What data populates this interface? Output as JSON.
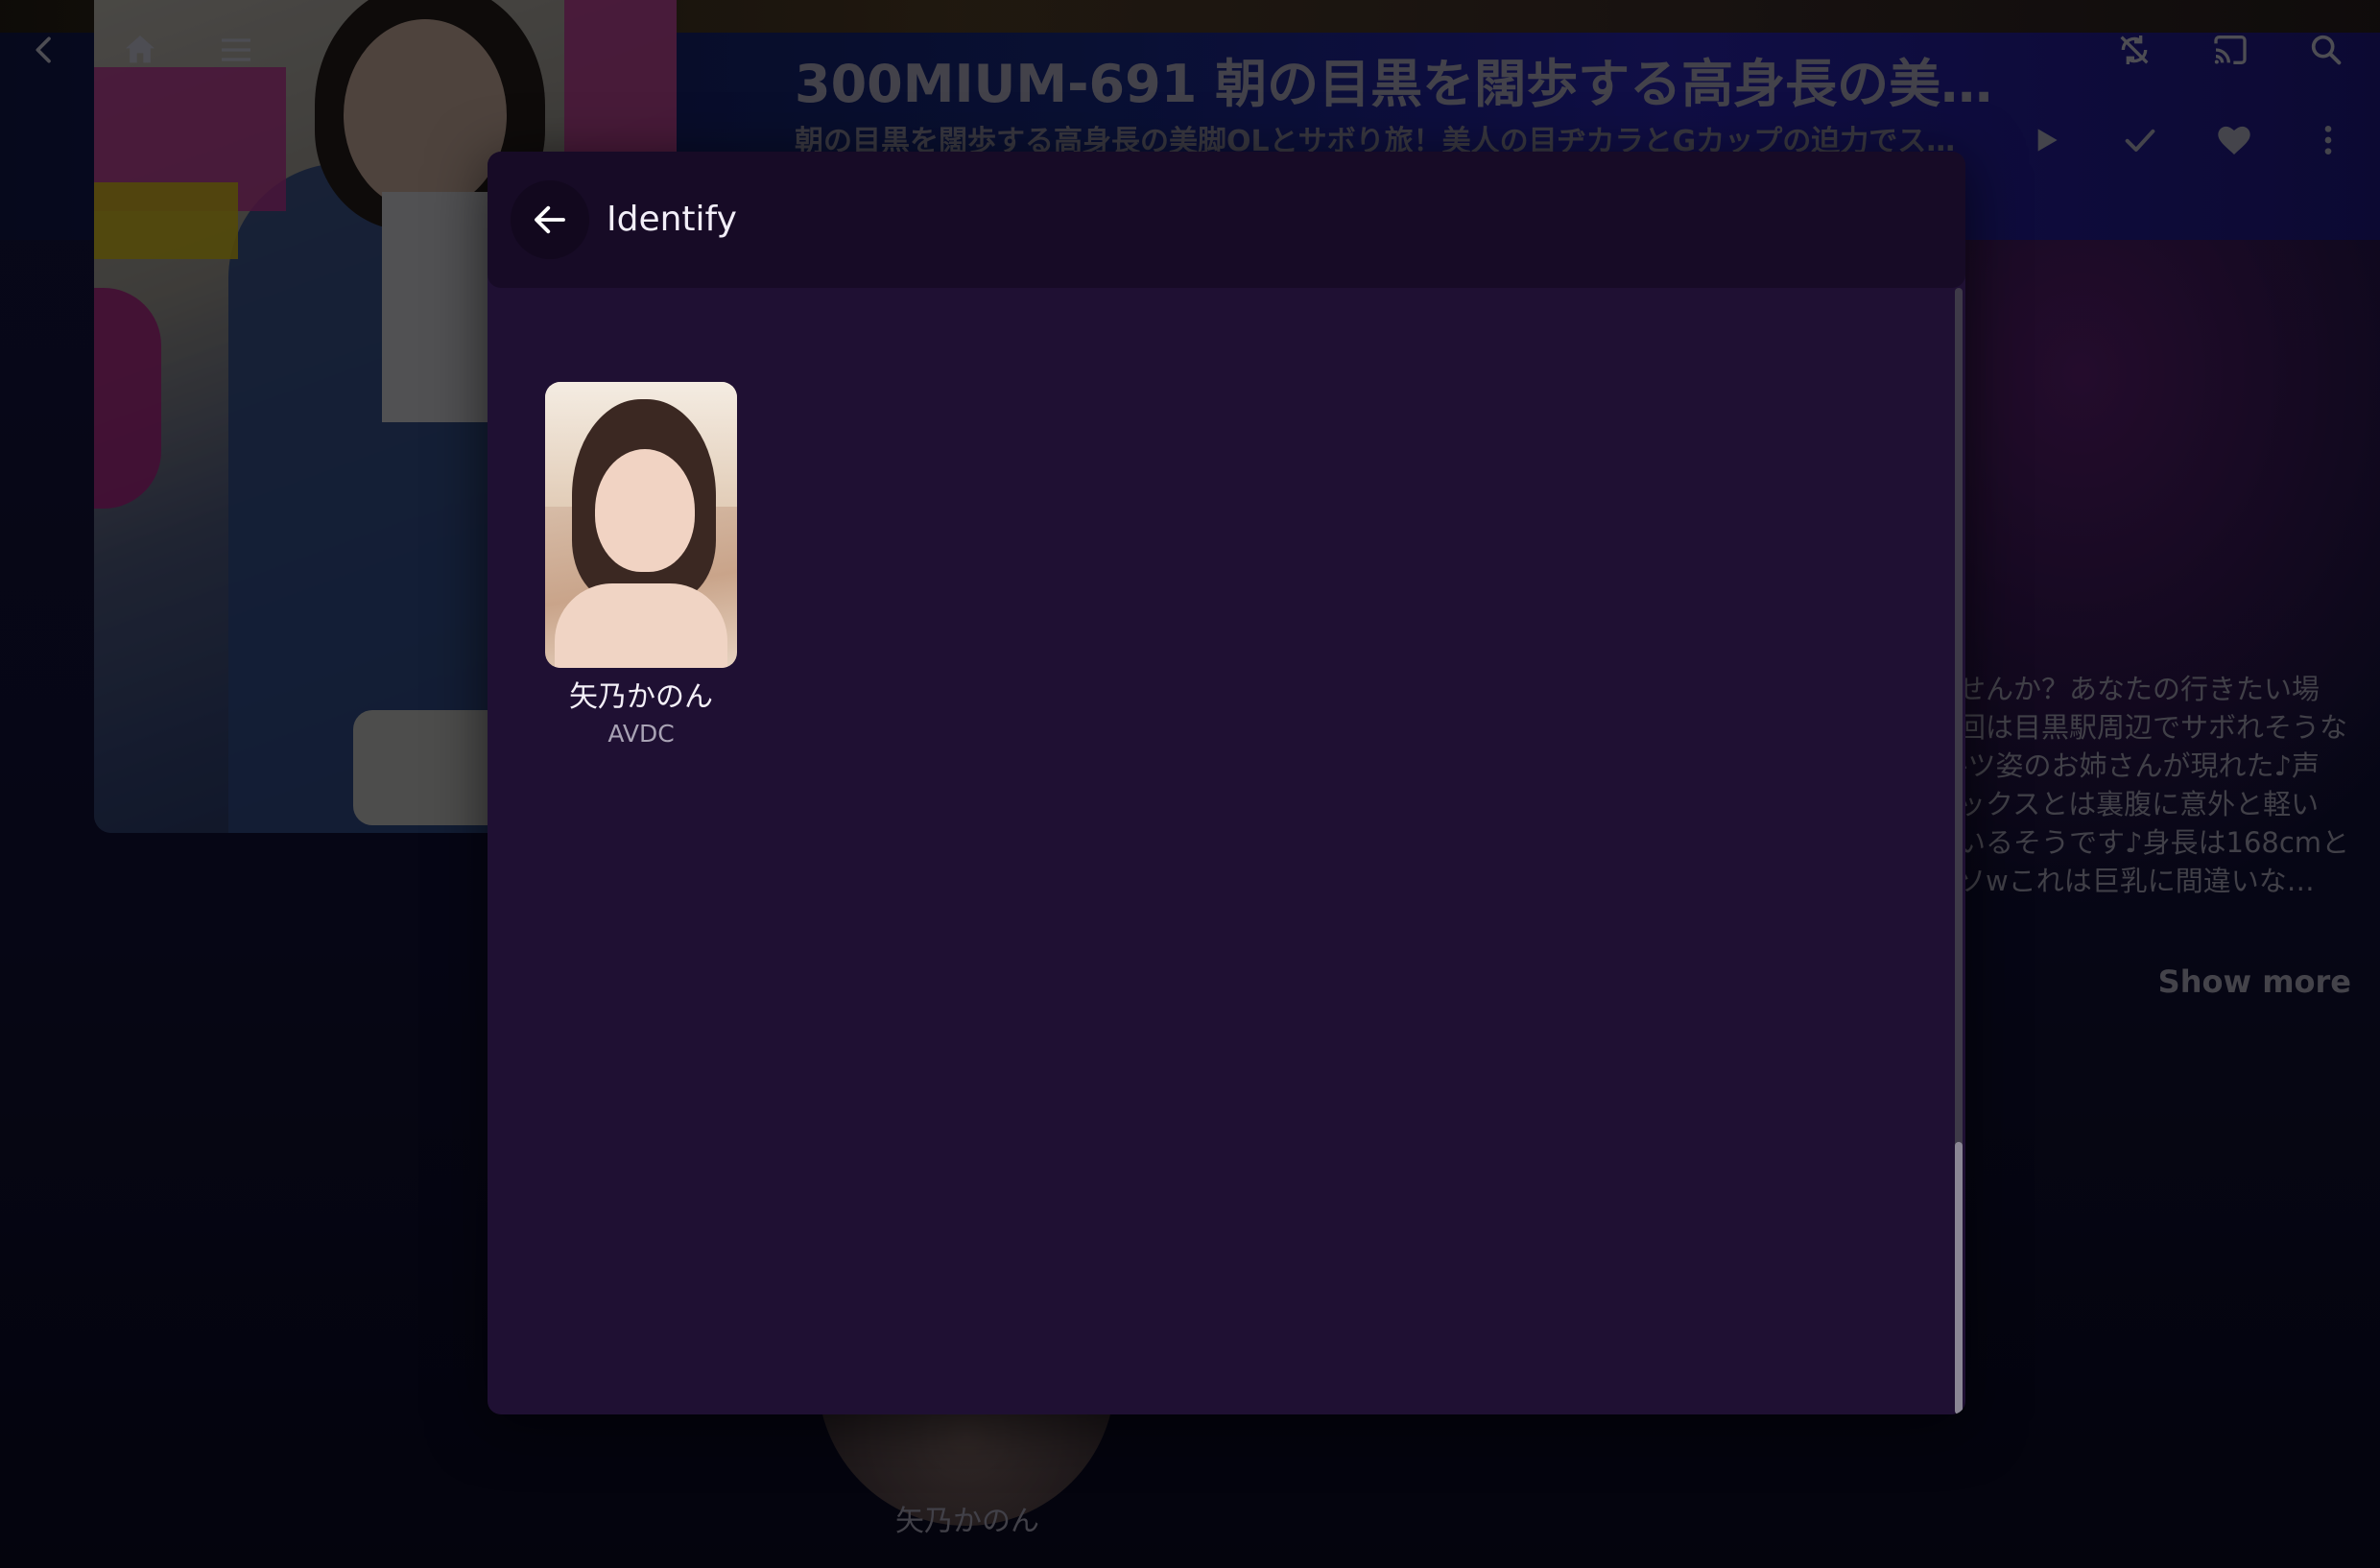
{
  "app": {
    "title": "300MIUM-691 朝の目黒を闊歩する高身長の美脚…",
    "subtitle": "朝の目黒を闊歩する高身長の美脚OLとサボり旅！美人の目ヂカラとGカップの迫力でスタ…",
    "overview": "せんか？あなたの行きたい場\n回は目黒駅周辺でサボれそうな\n-ツ姿のお姉さんが現れた♪声\nックスとは裏腹に意外と軽い\nいるそうです♪身長は168cmと\nソwこれは巨乳に間違いな…",
    "show_more_label": "Show more",
    "cast_name": "矢乃かのん"
  },
  "topbar": {
    "icons": [
      "back-icon",
      "home-icon",
      "menu-icon",
      "sync-disabled-icon",
      "cast-icon",
      "search-icon"
    ]
  },
  "actions": {
    "icons": [
      "play-icon",
      "check-icon",
      "heart-icon",
      "more-vert-icon"
    ]
  },
  "dialog": {
    "title": "Identify",
    "results": [
      {
        "name": "矢乃かのん",
        "source": "AVDC"
      }
    ]
  },
  "colors": {
    "dialog_bg": "#1f1033",
    "dialog_header_bg": "#170b26",
    "page_bg": "#0b0b22"
  }
}
